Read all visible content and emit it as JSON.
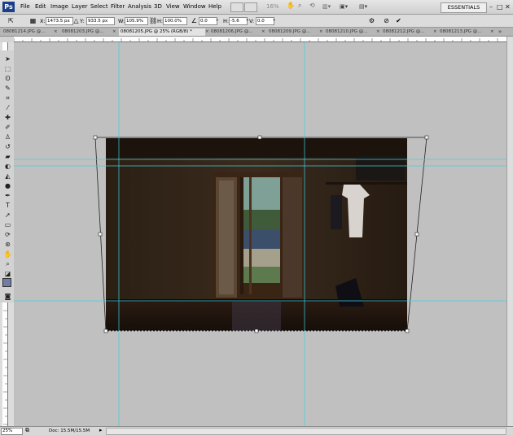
{
  "app": {
    "logo": "Ps"
  },
  "menu": [
    "File",
    "Edit",
    "Image",
    "Layer",
    "Select",
    "Filter",
    "Analysis",
    "3D",
    "View",
    "Window",
    "Help"
  ],
  "toolbar_zoom": "16%",
  "workspace": "ESSENTIALS",
  "window_buttons": {
    "minimize": "–",
    "restore": "□",
    "close": "✕"
  },
  "options": {
    "x_label": "X:",
    "x_value": "1473.5 px",
    "y_label": "Y:",
    "y_value": "933.5 px",
    "w_label": "W:",
    "w_value": "105.9%",
    "h_label": "H:",
    "h_value": "100.0%",
    "angle_value": "0.0",
    "hskew_label": "H:",
    "hskew_value": "-5.6",
    "vskew_label": "V:",
    "vskew_value": "0.0",
    "cancel_icon": "⊘",
    "commit_icon": "✔"
  },
  "tabs": [
    {
      "label": "08081214.JPG @...",
      "active": false
    },
    {
      "label": "08081203.JPG @...",
      "active": false
    },
    {
      "label": "08081205.JPG @ 25% (RGB/8) *",
      "active": true
    },
    {
      "label": "08081206.JPG @...",
      "active": false
    },
    {
      "label": "08081209.JPG @...",
      "active": false
    },
    {
      "label": "08081210.JPG @...",
      "active": false
    },
    {
      "label": "08081212.JPG @...",
      "active": false
    },
    {
      "label": "08081213.JPG @...",
      "active": false
    }
  ],
  "status": {
    "zoom": "25%",
    "doc": "Doc: 15.5M/15.5M"
  },
  "colors": {
    "guide": "#3fd0e0",
    "canvas_bg": "#c0c0c0"
  }
}
